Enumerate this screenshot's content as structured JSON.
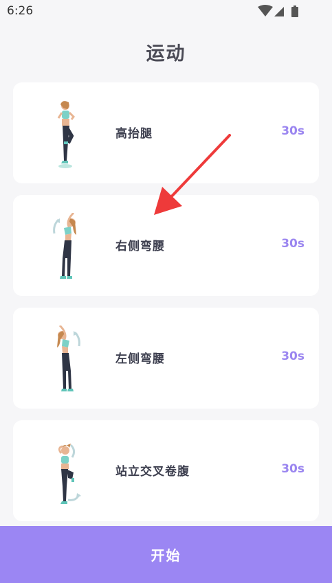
{
  "status": {
    "time": "6:26",
    "icons": [
      "wifi-icon",
      "signal-icon",
      "battery-icon"
    ]
  },
  "page": {
    "title": "运动"
  },
  "exercises": [
    {
      "name": "高抬腿",
      "duration": "30s",
      "icon": "high-knees-figure"
    },
    {
      "name": "右侧弯腰",
      "duration": "30s",
      "icon": "right-side-bend-figure"
    },
    {
      "name": "左侧弯腰",
      "duration": "30s",
      "icon": "left-side-bend-figure"
    },
    {
      "name": "站立交叉卷腹",
      "duration": "30s",
      "icon": "standing-cross-crunch-figure"
    }
  ],
  "start_button": {
    "label": "开始"
  },
  "colors": {
    "accent": "#9b86f3",
    "duration_text": "#9b86f0",
    "title_text": "#4a4a55",
    "arrow": "#ee3a3a",
    "background": "#f6f6f8"
  }
}
